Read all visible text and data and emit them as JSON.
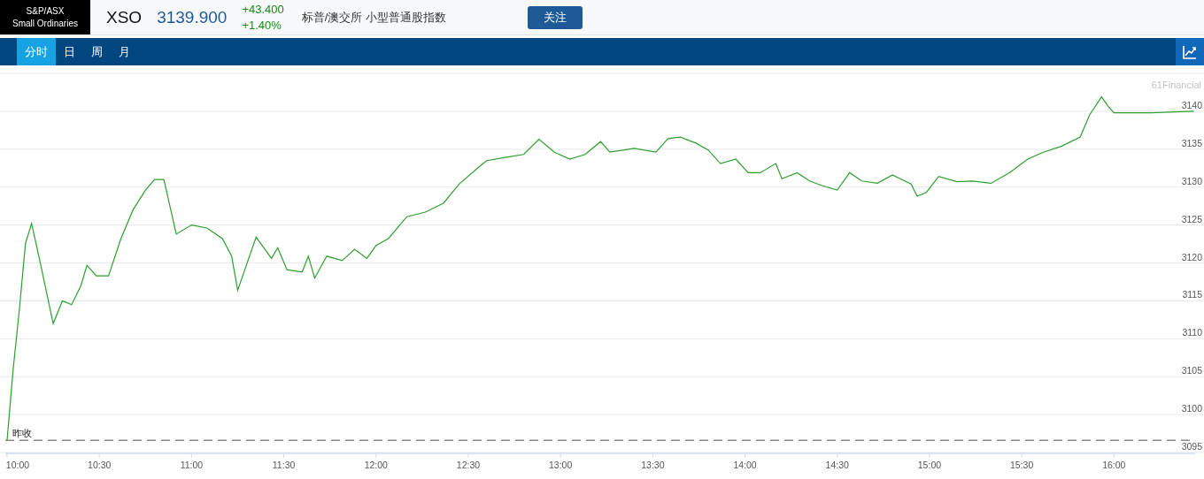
{
  "header": {
    "logo": [
      "S&P/ASX",
      "Small Ordinaries"
    ],
    "symbol": "XSO",
    "price": "3139.900",
    "change": "+43.400",
    "change_pct": "+1.40%",
    "name": "标普/澳交所 小型普通股指数",
    "follow_button": "关注"
  },
  "tabs": [
    {
      "label": "分时",
      "selected": true
    },
    {
      "label": "日",
      "selected": false
    },
    {
      "label": "周",
      "selected": false
    },
    {
      "label": "月",
      "selected": false
    }
  ],
  "watermark": "61Financial",
  "chart_data": {
    "type": "line",
    "x": [
      10,
      10.033,
      10.067,
      10.1,
      10.133,
      10.183,
      10.233,
      10.25,
      10.3,
      10.35,
      10.4,
      10.433,
      10.483,
      10.55,
      10.617,
      10.683,
      10.75,
      10.8,
      10.85,
      10.917,
      11,
      11.083,
      11.167,
      11.217,
      11.25,
      11.35,
      11.433,
      11.467,
      11.517,
      11.6,
      11.633,
      11.667,
      11.733,
      11.817,
      11.883,
      11.95,
      12,
      12.067,
      12.167,
      12.267,
      12.367,
      12.45,
      12.55,
      12.6,
      12.7,
      12.8,
      12.883,
      12.967,
      13.05,
      13.133,
      13.217,
      13.267,
      13.4,
      13.517,
      13.583,
      13.65,
      13.733,
      13.8,
      13.867,
      13.95,
      14.017,
      14.083,
      14.167,
      14.2,
      14.283,
      14.35,
      14.417,
      14.5,
      14.567,
      14.633,
      14.717,
      14.8,
      14.9,
      14.933,
      14.983,
      15.05,
      15.15,
      15.233,
      15.333,
      15.433,
      15.533,
      15.617,
      15.717,
      15.817,
      15.867,
      15.933,
      15.967,
      16,
      16.2,
      16.433
    ],
    "series": [
      {
        "color": "#2f9e2f",
        "values": [
          3096.6,
          3106,
          3114,
          3122.6,
          3125.2,
          3119.7,
          3113.9,
          3112,
          3115,
          3114.5,
          3117,
          3119.7,
          3118.3,
          3118.3,
          3123.2,
          3127,
          3129.6,
          3131,
          3131,
          3123.8,
          3125,
          3124.6,
          3123.2,
          3120.9,
          3116.4,
          3123.4,
          3120.6,
          3122,
          3119.1,
          3118.8,
          3120.9,
          3118,
          3120.9,
          3120.3,
          3121.8,
          3120.6,
          3122.3,
          3123.2,
          3126.1,
          3126.7,
          3127.9,
          3130.4,
          3132.5,
          3133.5,
          3133.9,
          3134.3,
          3136.3,
          3134.6,
          3133.7,
          3134.3,
          3136,
          3134.6,
          3135.1,
          3134.6,
          3136.4,
          3136.6,
          3135.8,
          3134.9,
          3133.1,
          3133.7,
          3131.9,
          3131.9,
          3133.1,
          3131.1,
          3131.9,
          3130.8,
          3130.2,
          3129.6,
          3131.9,
          3130.8,
          3130.5,
          3131.6,
          3130.4,
          3128.8,
          3129.3,
          3131.4,
          3130.7,
          3130.8,
          3130.5,
          3131.9,
          3133.7,
          3134.6,
          3135.4,
          3136.6,
          3139.5,
          3141.9,
          3140.7,
          3139.8,
          3139.8,
          3140
        ]
      }
    ],
    "xlim": [
      10,
      16.44
    ],
    "ylim": [
      3095,
      3145
    ],
    "xticks": [
      {
        "value": 10,
        "label": "10:00"
      },
      {
        "value": 10.5,
        "label": "10:30"
      },
      {
        "value": 11,
        "label": "11:00"
      },
      {
        "value": 11.5,
        "label": "11:30"
      },
      {
        "value": 12,
        "label": "12:00"
      },
      {
        "value": 12.5,
        "label": "12:30"
      },
      {
        "value": 13,
        "label": "13:00"
      },
      {
        "value": 13.5,
        "label": "13:30"
      },
      {
        "value": 14,
        "label": "14:00"
      },
      {
        "value": 14.5,
        "label": "14:30"
      },
      {
        "value": 15,
        "label": "15:00"
      },
      {
        "value": 15.5,
        "label": "15:30"
      },
      {
        "value": 16,
        "label": "16:00"
      }
    ],
    "yticks": [
      3095,
      3100,
      3105,
      3110,
      3115,
      3120,
      3125,
      3130,
      3135,
      3140
    ],
    "grid": true,
    "ref_lines": [
      {
        "axis": "y",
        "value": 3096.6,
        "label": "昨收"
      }
    ]
  }
}
